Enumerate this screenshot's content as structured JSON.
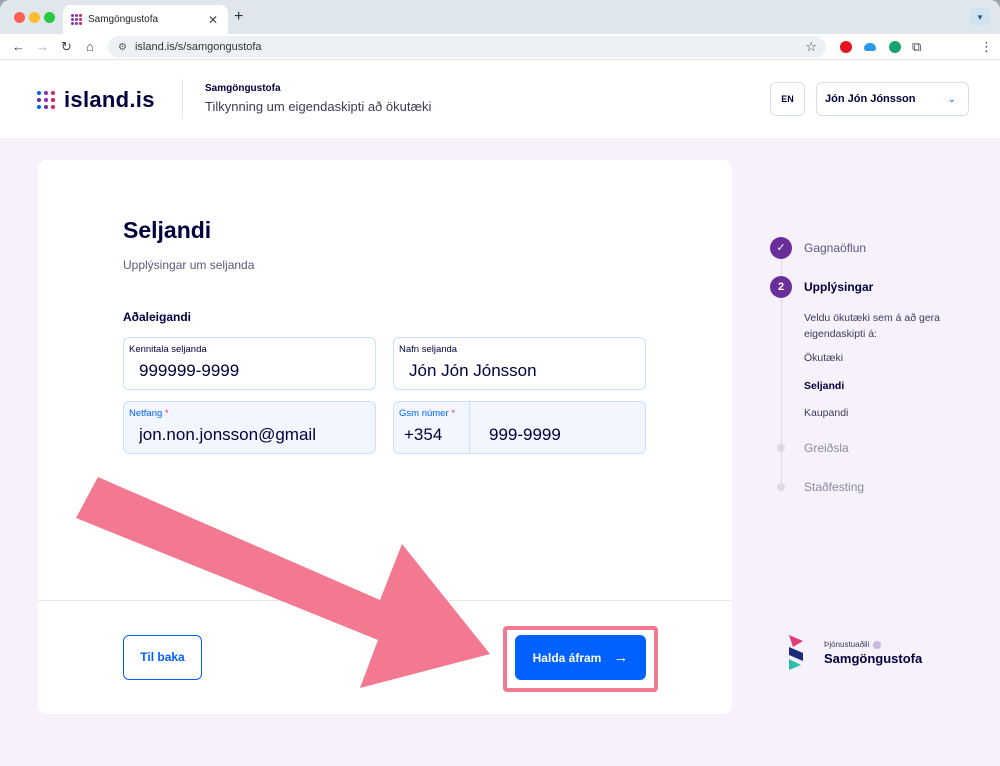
{
  "browser": {
    "tab_title": "Samgöngustofa",
    "new_tab": "+",
    "close": "✕",
    "url": "island.is/s/samgongustofa",
    "back": "←",
    "forward": "→",
    "reload": "↻",
    "home": "⌂"
  },
  "header": {
    "logo_text": "island.is",
    "org_name": "Samgöngustofa",
    "form_name": "Tilkynning um eigendaskipti að ökutæki",
    "lang_label": "EN",
    "user_name": "Jón Jón Jónsson"
  },
  "form": {
    "title": "Seljandi",
    "subtitle": "Upplýsingar um seljanda",
    "section_title": "Aðaleigandi",
    "fields": {
      "kennitala": {
        "label": "Kennitala seljanda",
        "value": "999999-9999"
      },
      "nafn": {
        "label": "Nafn seljanda",
        "value": "Jón Jón Jónsson"
      },
      "netfang": {
        "label": "Netfang",
        "required": "*",
        "value": "jon.non.jonsson@gmail"
      },
      "gsm": {
        "label": "Gsm númer",
        "required": "*",
        "country_code": "+354",
        "value": "999-9999"
      }
    },
    "back_label": "Til baka",
    "continue_label": "Halda áfram",
    "continue_arrow": "→"
  },
  "stepper": {
    "steps": [
      {
        "label": "Gagnaöflun",
        "state": "done",
        "mark": "✓"
      },
      {
        "label": "Upplýsingar",
        "state": "active",
        "mark": "2"
      },
      {
        "label": "Greiðsla",
        "state": "pending"
      },
      {
        "label": "Staðfesting",
        "state": "pending"
      }
    ],
    "substep_description": "Veldu ökutæki sem á að gera eigendaskipti á:",
    "substeps": [
      {
        "label": "Ökutæki",
        "active": false
      },
      {
        "label": "Seljandi",
        "active": true
      },
      {
        "label": "Kaupandi",
        "active": false
      }
    ]
  },
  "provider": {
    "caption": "Þjónustuaðili",
    "name": "Samgöngustofa"
  },
  "colors": {
    "primary_blue": "#0061ff",
    "step_purple": "#6a2e9a",
    "annotation_pink": "#f2798f",
    "page_background": "#f6f1fb"
  },
  "icons": {
    "check": "check-icon",
    "arrow": "arrow-right-icon",
    "chevron": "chevron-down-icon"
  }
}
